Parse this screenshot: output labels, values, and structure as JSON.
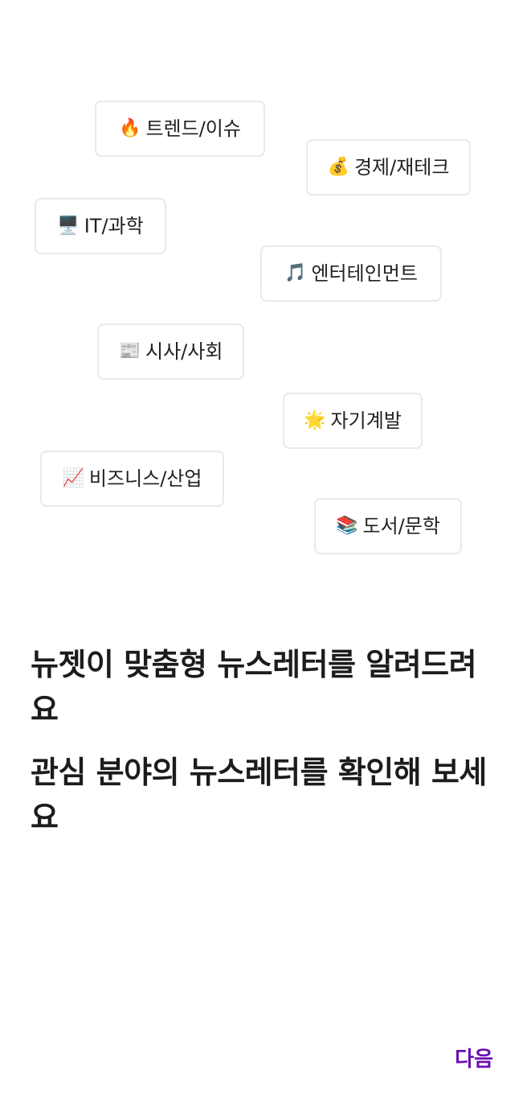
{
  "categories": [
    {
      "emoji": "🔥",
      "label": "트렌드/이슈",
      "icon": "fire-icon"
    },
    {
      "emoji": "💰",
      "label": "경제/재테크",
      "icon": "money-bag-icon"
    },
    {
      "emoji": "🖥️",
      "label": "IT/과학",
      "icon": "desktop-computer-icon"
    },
    {
      "emoji": "🎵",
      "label": "엔터테인먼트",
      "icon": "music-note-icon"
    },
    {
      "emoji": "📰",
      "label": "시사/사회",
      "icon": "newspaper-icon"
    },
    {
      "emoji": "🌟",
      "label": "자기계발",
      "icon": "glowing-star-icon"
    },
    {
      "emoji": "📈",
      "label": "비즈니스/산업",
      "icon": "chart-increasing-icon"
    },
    {
      "emoji": "📚",
      "label": "도서/문학",
      "icon": "books-icon"
    }
  ],
  "headline": {
    "line1": "뉴젯이 맞춤형 뉴스레터를 알려드려요",
    "line2": "관심 분야의 뉴스레터를 확인해 보세요"
  },
  "footer": {
    "next_label": "다음"
  },
  "colors": {
    "accent": "#6a0fb0",
    "chip_border": "#e6e9ee",
    "text": "#1c1c1c"
  }
}
